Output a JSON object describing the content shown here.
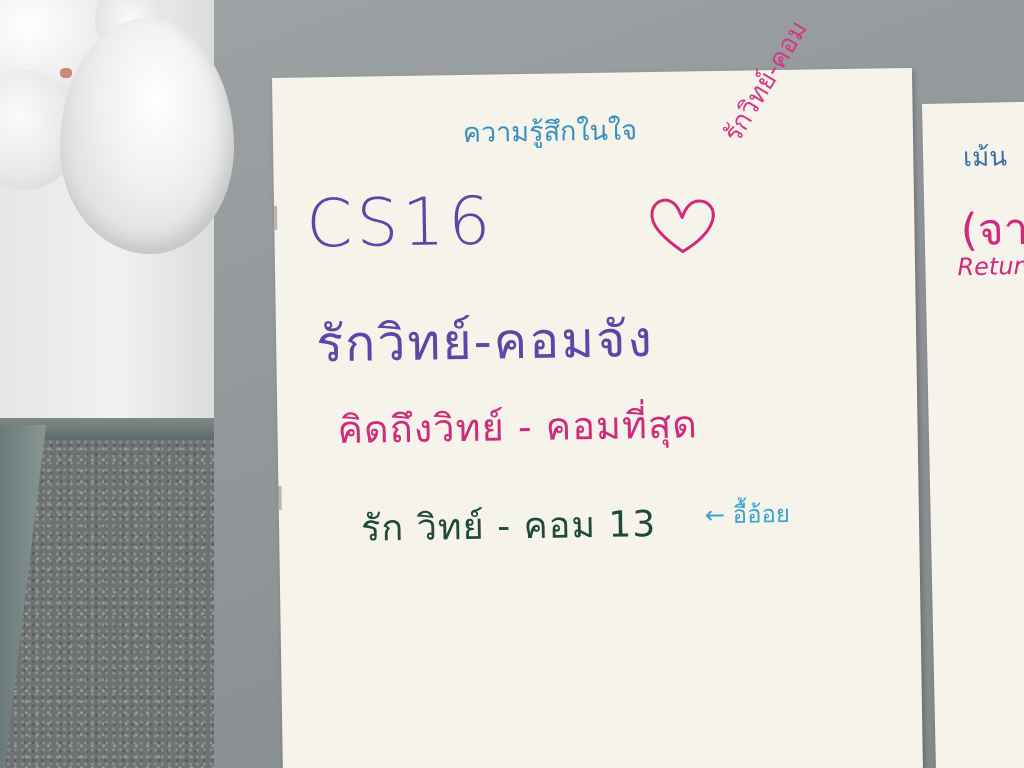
{
  "scene": {
    "description_colors": {
      "board": "#8e9395",
      "paper": "#f6f4ea",
      "balloon": "#f0f0f0"
    }
  },
  "poster": {
    "heading": "ความรู้สึกในใจ",
    "corner_note": "รักวิทย์-คอม",
    "title": "CS16",
    "heart_icon": "heart-icon",
    "line_1": "รักวิทย์-คอมจัง",
    "line_2": "คิดถึงวิทย์ - คอมที่สุด",
    "line_3": "รัก วิทย์ - คอม 13",
    "arrow_note": "← อื้อ้อย",
    "colors": {
      "blue": "#3a8fc0",
      "purple": "#5b47a8",
      "pink": "#d22a7a",
      "green": "#1f4a3a"
    }
  },
  "poster_right": {
    "line_1": "เม้น",
    "line_2": "(จา",
    "line_3": "Retur"
  }
}
